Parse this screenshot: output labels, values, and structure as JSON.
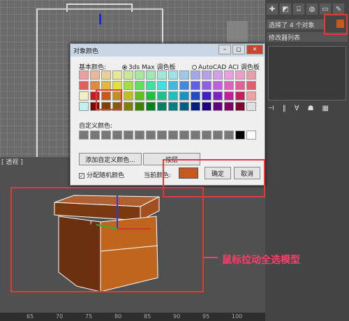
{
  "viewport_bottom": {
    "label": "[ 透视 ]"
  },
  "ruler": {
    "ticks": [
      "65",
      "70",
      "75",
      "80",
      "85",
      "90",
      "95",
      "100"
    ]
  },
  "right_panel": {
    "selection_text": "选择了 4 个对象",
    "modifier_list": "修改器列表",
    "object_color": "#c65a1e"
  },
  "dialog": {
    "title": "对象颜色",
    "basic_colors_label": "基本颜色:",
    "radio_3dsmax": "3ds Max 调色板",
    "radio_autocad": "AutoCAD ACI 调色板",
    "custom_colors_label": "自定义颜色:",
    "add_custom_button": "添加自定义颜色...",
    "by_layer_button": "按层",
    "random_color_checkbox": "分配随机颜色",
    "current_color_label": "当前颜色:",
    "ok_button": "确定",
    "cancel_button": "取消",
    "current_color": "#c65a1e",
    "palette": [
      "#e8a0a0",
      "#e8b898",
      "#e8d098",
      "#e8e898",
      "#c8e898",
      "#a8e8a0",
      "#a0e8b8",
      "#a0e8d8",
      "#a0e0e8",
      "#a0c8e8",
      "#a0a8e8",
      "#b8a0e8",
      "#d0a0e8",
      "#e8a0e0",
      "#e8a0c8",
      "#e8a0a8",
      "#e06060",
      "#e08840",
      "#e0b840",
      "#e0e040",
      "#a0e040",
      "#60e060",
      "#40e0a0",
      "#40e0e0",
      "#40b8e0",
      "#4088e0",
      "#6060e0",
      "#9060e0",
      "#c060e0",
      "#e060c0",
      "#e06098",
      "#e06070",
      "#f0f0c0",
      "#c02020",
      "#c65a1e",
      "#c09020",
      "#c0c020",
      "#60c020",
      "#20c040",
      "#20c090",
      "#20c0c0",
      "#2090c0",
      "#2050c0",
      "#4020c0",
      "#8020c0",
      "#c020a0",
      "#c02060",
      "#f0a0a0",
      "#c0f0f0",
      "#800000",
      "#804000",
      "#806000",
      "#808000",
      "#408000",
      "#008020",
      "#008060",
      "#008080",
      "#006080",
      "#002080",
      "#200080",
      "#600080",
      "#800060",
      "#800030",
      "#e0e0e0"
    ],
    "custom_colors": [
      "#777777",
      "#777777",
      "#777777",
      "#777777",
      "#777777",
      "#777777",
      "#777777",
      "#777777",
      "#777777",
      "#777777",
      "#777777",
      "#777777",
      "#777777",
      "#777777",
      "#000000",
      "#ffffff"
    ]
  },
  "annotation": {
    "text": "鼠标拉动全选模型"
  }
}
